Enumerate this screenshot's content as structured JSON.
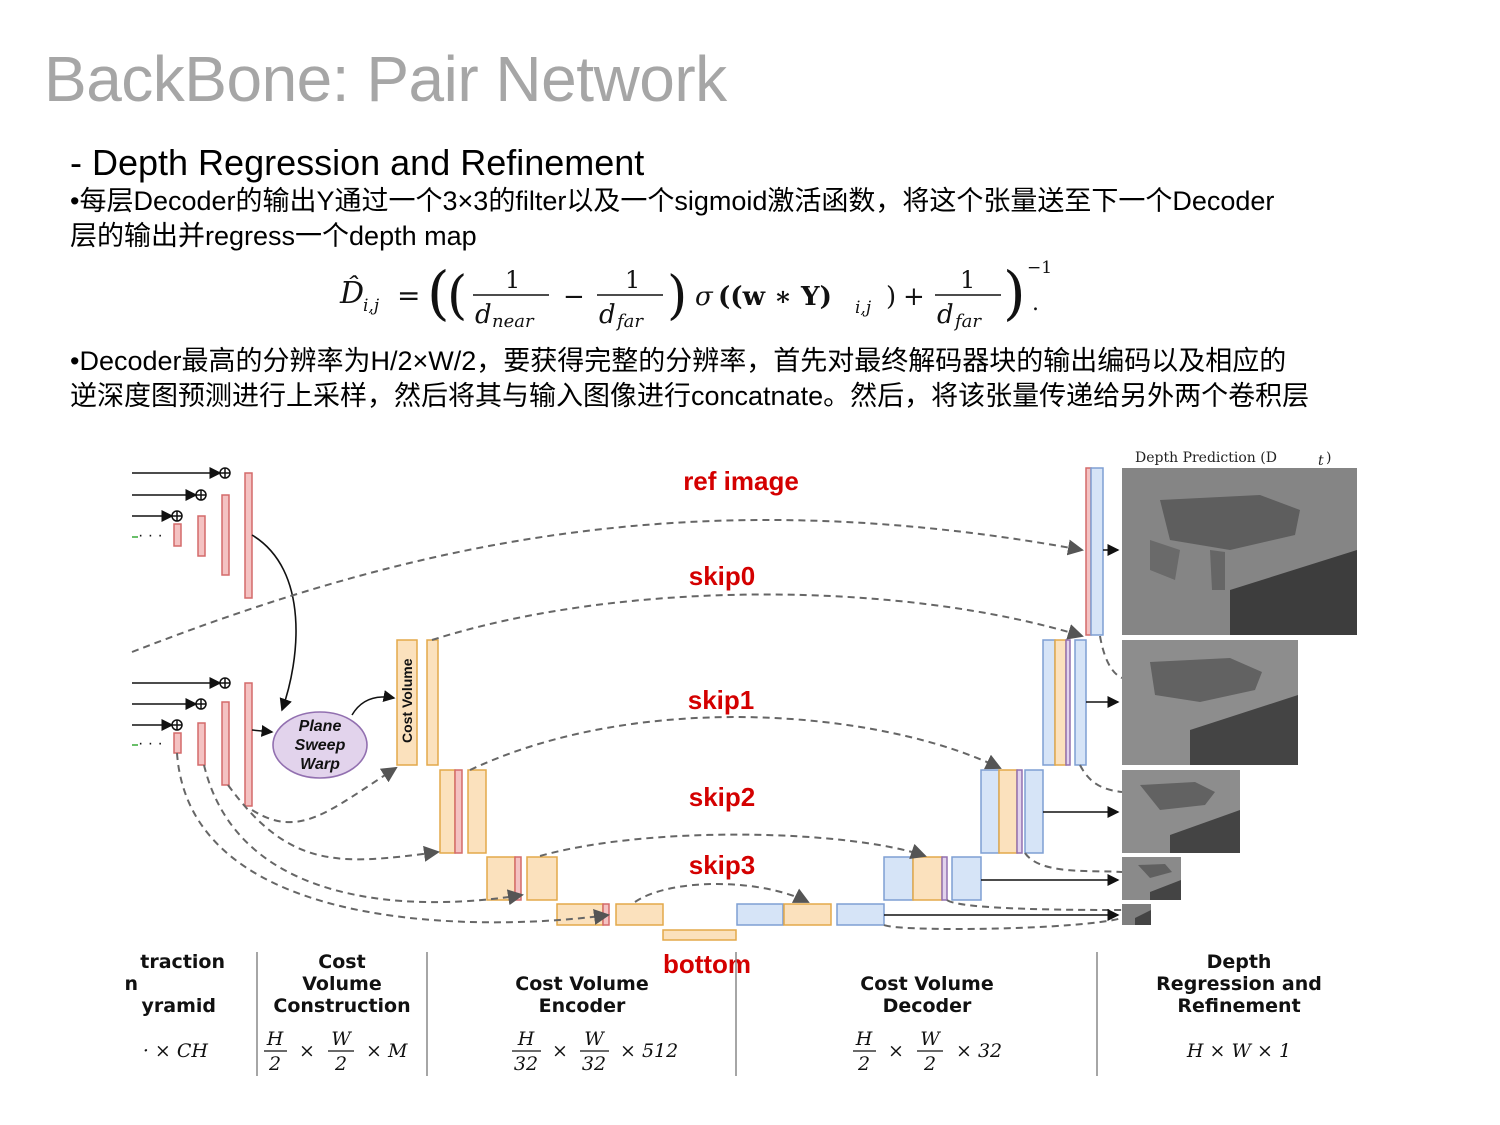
{
  "slide": {
    "title": "BackBone: Pair Network",
    "subtitle": "- Depth Regression and Refinement",
    "para1_line1": "•每层Decoder的输出Y通过一个3×3的filter以及一个sigmoid激活函数，将这个张量送至下一个Decoder",
    "para1_line2": "层的输出并regress一个depth map",
    "para2_line1": "•Decoder最高的分辨率为H/2×W/2，要获得完整的分辨率，首先对最终解码器块的输出编码以及相应的",
    "para2_line2": "逆深度图预测进行上采样，然后将其与输入图像进行concatnate。然后，将该张量传递给另外两个卷积层"
  },
  "formula": {
    "lhs": "D̂",
    "lhs_sub": "i,j",
    "one": "1",
    "d_near": "d",
    "near_sub": "near",
    "d_far": "d",
    "far_sub": "far",
    "sigma": "σ",
    "inner": "((w ∗ Y)",
    "inner_sub": "i,j",
    "exp": "−1"
  },
  "diagram": {
    "labels": {
      "ref_image": "ref image",
      "skip0": "skip0",
      "skip1": "skip1",
      "skip2": "skip2",
      "skip3": "skip3",
      "bottom": "bottom"
    },
    "plane_sweep": [
      "Plane",
      "Sweep",
      "Warp"
    ],
    "cost_volume": "Cost Volume",
    "depth_prediction": "Depth Prediction (D",
    "depth_prediction_sub": "t",
    "sections": [
      {
        "lines": [
          "traction",
          "n",
          "yramid"
        ],
        "dim": "· × CH"
      },
      {
        "lines": [
          "Cost",
          "Volume",
          "Construction"
        ],
        "dim_num1": "H",
        "dim_den1": "2",
        "dim_num2": "W",
        "dim_den2": "2",
        "dim_tail": "× M"
      },
      {
        "lines": [
          "Cost Volume",
          "Encoder"
        ],
        "dim_num1": "H",
        "dim_den1": "32",
        "dim_num2": "W",
        "dim_den2": "32",
        "dim_tail": "× 512"
      },
      {
        "lines": [
          "Cost Volume",
          "Decoder"
        ],
        "dim_num1": "H",
        "dim_den1": "2",
        "dim_num2": "W",
        "dim_den2": "2",
        "dim_tail": "× 32"
      },
      {
        "lines": [
          "Depth",
          "Regression and",
          "Refinement"
        ],
        "dim": "H × W × 1"
      }
    ],
    "colors": {
      "pink_fill": "#f4c2c2",
      "pink_stroke": "#d46a6a",
      "orange_fill": "#fbe1bd",
      "orange_stroke": "#e3a94a",
      "blue_fill": "#d6e4f7",
      "blue_stroke": "#7f9fd3",
      "purple_fill": "#e2d3ec",
      "purple_stroke": "#9270b0",
      "label_red": "#d40000"
    }
  }
}
